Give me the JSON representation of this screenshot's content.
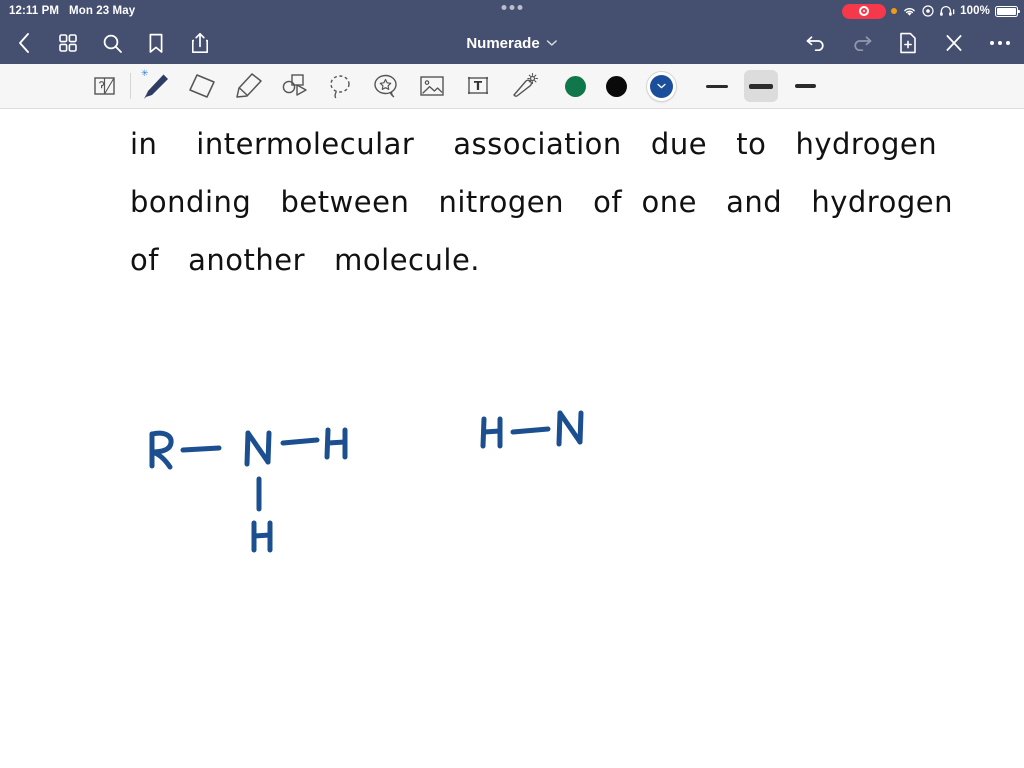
{
  "status_bar": {
    "time": "12:11 PM",
    "date": "Mon 23 May",
    "battery_percent": "100%",
    "icons": [
      "recording-pill",
      "orange-privacy-dot",
      "wifi-icon",
      "control-center-icon",
      "headphones-icon",
      "battery-icon"
    ],
    "navy": "#454f70"
  },
  "nav_bar": {
    "title": "Numerade",
    "left_icons": [
      "back-chevron-icon",
      "grid-icon",
      "search-icon",
      "bookmark-icon",
      "share-icon"
    ],
    "right_icons": [
      "undo-icon",
      "redo-icon",
      "add-page-icon",
      "close-icon",
      "more-icon"
    ]
  },
  "toolbar": {
    "tools": [
      {
        "name": "page-layers-icon",
        "selected": false
      },
      {
        "name": "pen-icon",
        "selected": true,
        "badge": "bluetooth"
      },
      {
        "name": "eraser-icon",
        "selected": false
      },
      {
        "name": "highlighter-icon",
        "selected": false
      },
      {
        "name": "shapes-icon",
        "selected": false
      },
      {
        "name": "lasso-icon",
        "selected": false
      },
      {
        "name": "sticker-icon",
        "selected": false
      },
      {
        "name": "image-icon",
        "selected": false
      },
      {
        "name": "text-box-icon",
        "selected": false
      },
      {
        "name": "magic-wand-icon",
        "selected": false
      }
    ],
    "colors": [
      {
        "name": "color-green",
        "hex": "#10774a",
        "selected": false
      },
      {
        "name": "color-black",
        "hex": "#0a0a0a",
        "selected": false
      },
      {
        "name": "color-blue",
        "hex": "#1b4f9c",
        "selected": true
      }
    ],
    "stroke_widths": [
      {
        "name": "stroke-thin",
        "px": 3,
        "selected": false
      },
      {
        "name": "stroke-medium",
        "px": 5,
        "selected": true
      },
      {
        "name": "stroke-thick",
        "px": 4,
        "selected": false
      }
    ]
  },
  "canvas": {
    "ink_color_text": "#111111",
    "ink_color_diagram": "#1b4f8f",
    "handwritten_lines": [
      "in    intermolecular    association   due   to   hydrogen",
      "bonding   between   nitrogen   of  one   and   hydrogen",
      "of   another   molecule."
    ],
    "diagram": {
      "left_molecule": {
        "labels": [
          "R",
          "N",
          "H",
          "H"
        ],
        "description": "R bonded to N, N bonded to H on the right and H below"
      },
      "right_molecule": {
        "labels": [
          "H",
          "N"
        ],
        "description": "H bonded to N"
      }
    }
  }
}
